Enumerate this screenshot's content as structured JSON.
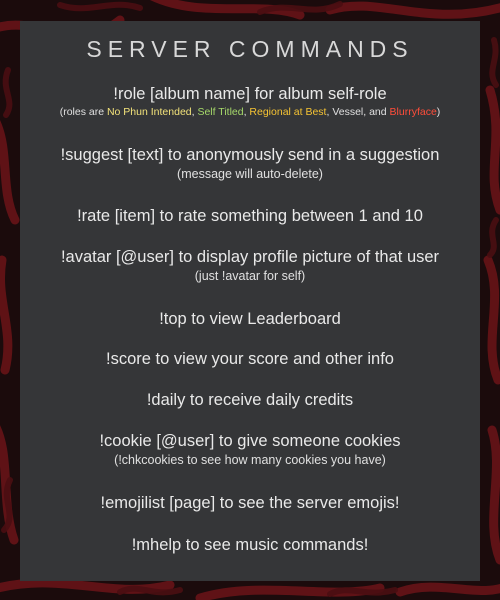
{
  "title": "SERVER COMMANDS",
  "colors": {
    "no_phun_intended": "#f2e27a",
    "self_titled": "#a6d96a",
    "regional_at_best": "#f5c333",
    "blurryface": "#ff4d3a"
  },
  "commands": [
    {
      "text": "!role [album name] for album self-role",
      "roles_note": {
        "prefix": "(roles are ",
        "no_phun_intended": "No Phun Intended",
        "sep1": ", ",
        "self_titled": "Self Titled",
        "sep2": ", ",
        "regional_at_best": "Regional at Best",
        "sep3": ", Vessel, and ",
        "blurryface": "Blurryface",
        "suffix": ")"
      }
    },
    {
      "text": "!suggest [text] to anonymously send in a suggestion",
      "note": "(message will auto-delete)"
    },
    {
      "text": "!rate [item] to rate something between 1 and 10"
    },
    {
      "text": "!avatar [@user] to display profile picture of that user",
      "note": "(just !avatar for self)"
    },
    {
      "text": "!top to view Leaderboard"
    },
    {
      "text": "!score to view your score and other info"
    },
    {
      "text": "!daily to receive daily credits"
    },
    {
      "text": "!cookie [@user] to give someone cookies",
      "note": "(!chkcookies to see how many cookies you have)"
    },
    {
      "text": "!emojilist [page] to see the server emojis!"
    },
    {
      "text": "!mhelp to see music commands!"
    }
  ]
}
